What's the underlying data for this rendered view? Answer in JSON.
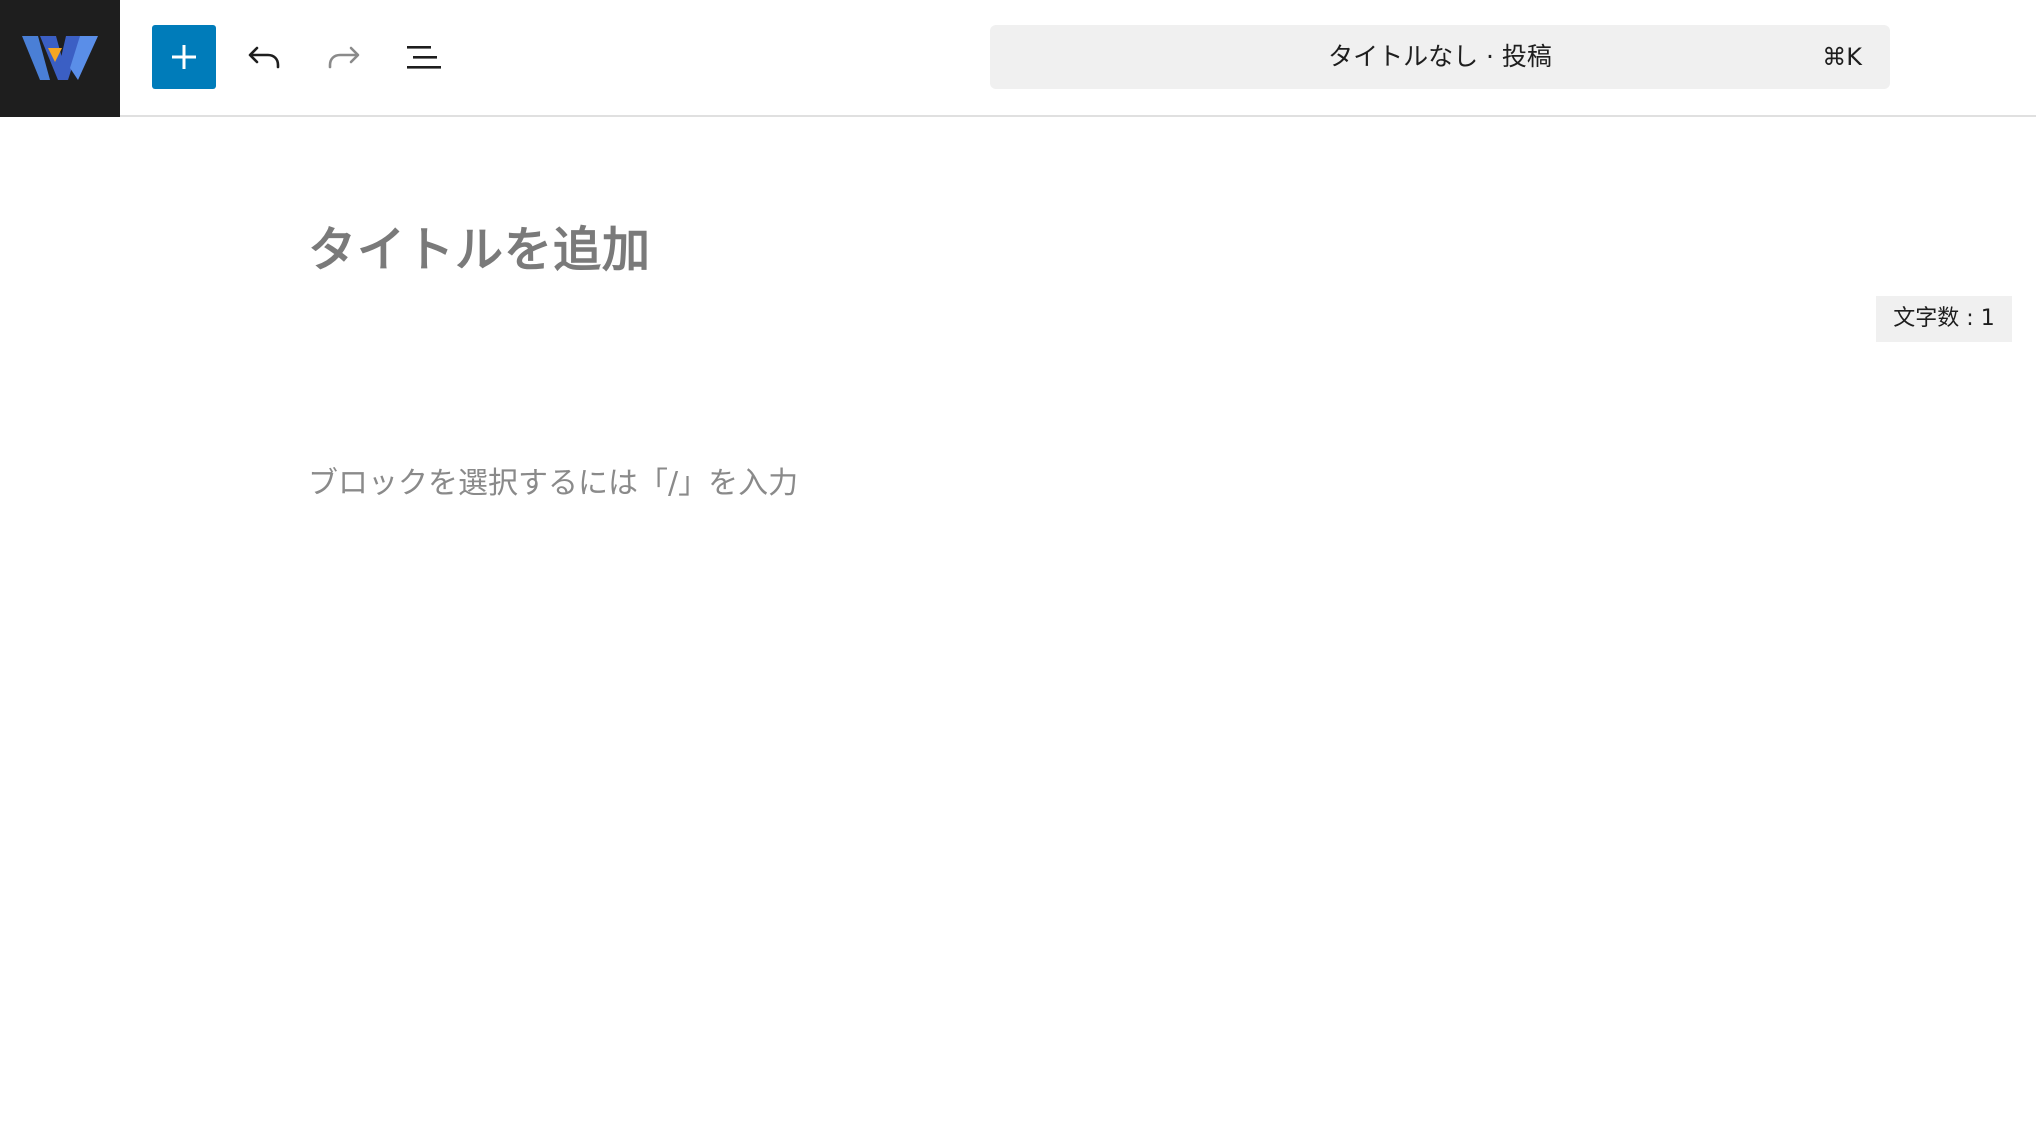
{
  "toolbar": {
    "logo_icon": "wordpress-w-logo",
    "inserter_icon": "plus-icon",
    "undo_icon": "undo-icon",
    "redo_icon": "redo-icon",
    "list_view_icon": "list-view-icon",
    "accent_color": "#007cba"
  },
  "command_bar": {
    "title": "タイトルなし · 投稿",
    "shortcut": "⌘K"
  },
  "editor": {
    "title_placeholder": "タイトルを追加",
    "block_placeholder": "ブロックを選択するには「/」を入力"
  },
  "word_count": {
    "label": "文字数 : 1"
  }
}
